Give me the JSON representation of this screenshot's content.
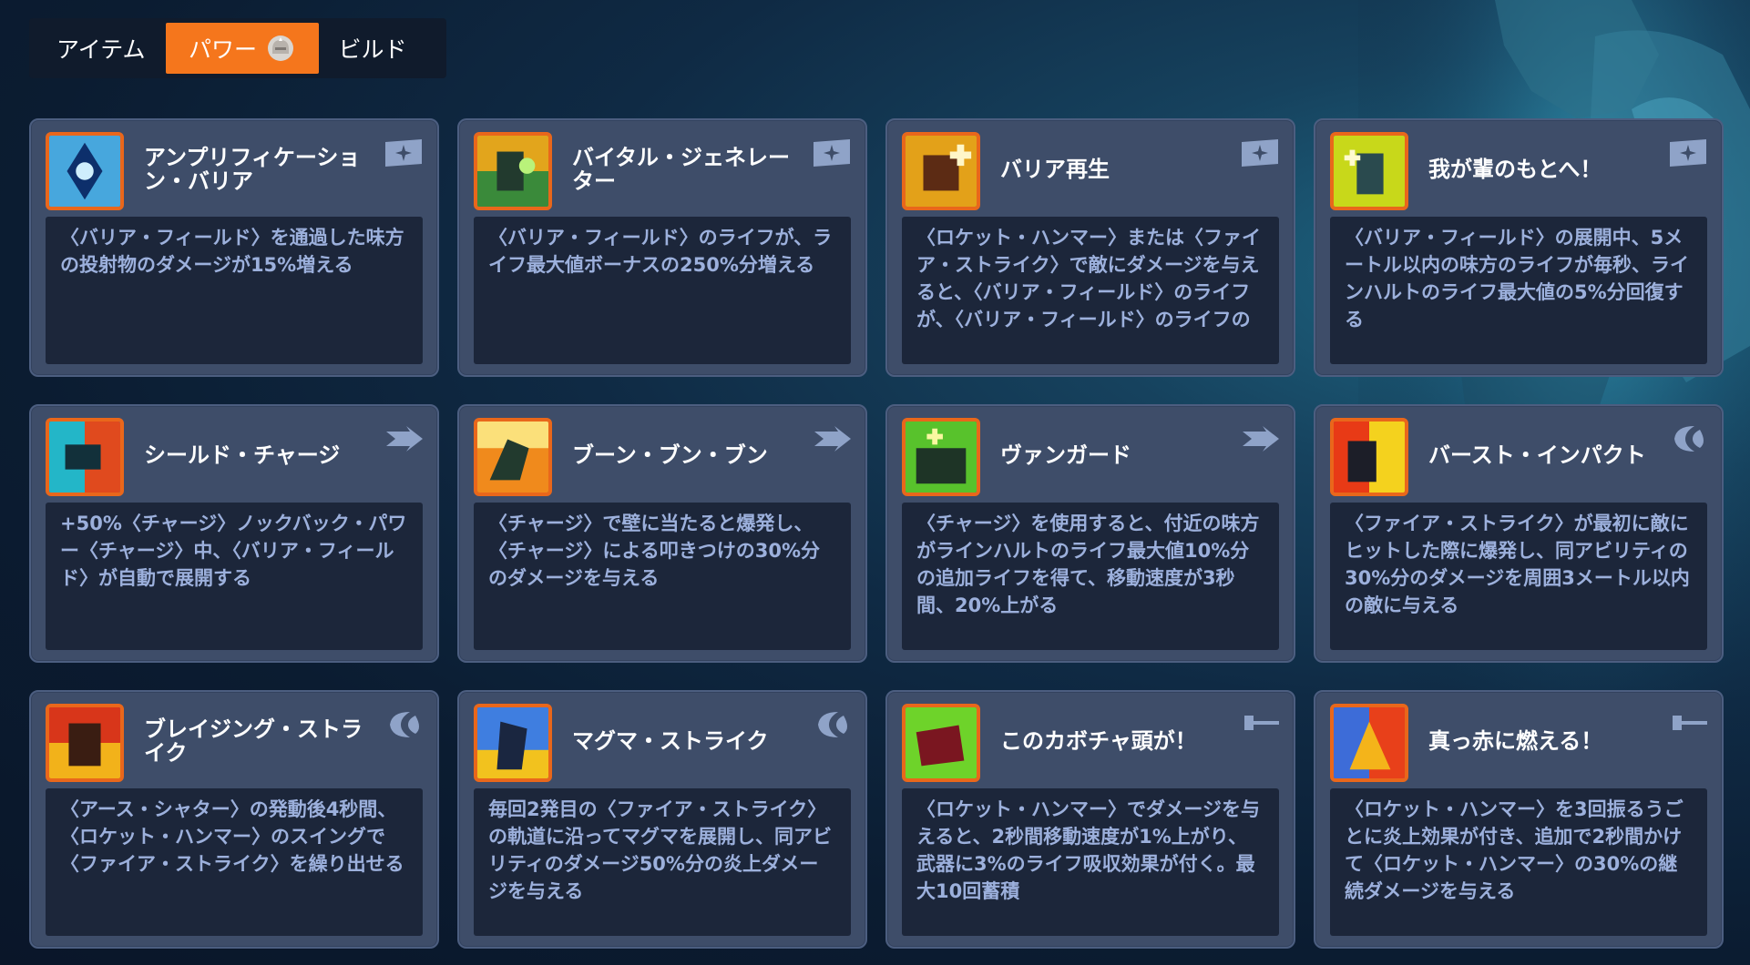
{
  "tabs": [
    {
      "label": "アイテム",
      "active": false
    },
    {
      "label": "パワー",
      "active": true,
      "icon": "helmet-icon"
    },
    {
      "label": "ビルド",
      "active": false
    }
  ],
  "colors": {
    "accent": "#f5761c",
    "card_bg": "#3e4d69",
    "desc_bg": "#1c263a",
    "highlight_text": "#9cb0dc"
  },
  "powers": [
    {
      "title": "アンプリフィケーション・バリア",
      "type_icon": "barrier-icon",
      "desc": [
        [
          "〈バリア・フィールド〉を通過した味方の投射物のダメージが",
          "w"
        ],
        [
          "15%",
          "w"
        ],
        [
          "増える",
          "w"
        ]
      ],
      "desc_text": "〈バリア・フィールド〉を通過した味方の投射物のダメージが15%増える"
    },
    {
      "title": "バイタル・ジェネレーター",
      "type_icon": "barrier-icon",
      "desc_text": "〈バリア・フィールド〉のライフが、ライフ最大値ボーナスの250%分増える"
    },
    {
      "title": "バリア再生",
      "type_icon": "barrier-icon",
      "desc_text": "〈ロケット・ハンマー〉または〈ファイア・ストライク〉で敵にダメージを与えると、〈バリア・フィールド〉のライフが、〈バリア・フィールド〉のライフの"
    },
    {
      "title": "我が輩のもとへ！",
      "type_icon": "barrier-icon",
      "desc_text": "〈バリア・フィールド〉の展開中、5メートル以内の味方のライフが毎秒、ラインハルトのライフ最大値の5%分回復する"
    },
    {
      "title": "シールド・チャージ",
      "type_icon": "charge-icon",
      "desc_text": "+50%〈チャージ〉ノックバック・パワー〈チャージ〉中、〈バリア・フィールド〉が自動で展開する"
    },
    {
      "title": "ブーン・ブン・ブン",
      "type_icon": "charge-icon",
      "desc_text": "〈チャージ〉で壁に当たると爆発し、〈チャージ〉による叩きつけの30%分のダメージを与える"
    },
    {
      "title": "ヴァンガード",
      "type_icon": "charge-icon",
      "desc_text": "〈チャージ〉を使用すると、付近の味方がラインハルトのライフ最大値10%分の追加ライフを得て、移動速度が3秒間、20%上がる"
    },
    {
      "title": "バースト・インパクト",
      "type_icon": "fire-strike-icon",
      "desc_text": "〈ファイア・ストライク〉が最初に敵にヒットした際に爆発し、同アビリティの30%分のダメージを周囲3メートル以内の敵に与える"
    },
    {
      "title": "ブレイジング・ストライク",
      "type_icon": "fire-strike-icon",
      "desc_text": "〈アース・シャター〉の発動後4秒間、〈ロケット・ハンマー〉のスイングで〈ファイア・ストライク〉を繰り出せる"
    },
    {
      "title": "マグマ・ストライク",
      "type_icon": "fire-strike-icon",
      "desc_text": "毎回2発目の〈ファイア・ストライク〉の軌道に沿ってマグマを展開し、同アビリティのダメージ50%分の炎上ダメージを与える"
    },
    {
      "title": "このカボチャ頭が！",
      "type_icon": "hammer-icon",
      "desc_text": "〈ロケット・ハンマー〉でダメージを与えると、2秒間移動速度が1%上がり、武器に3%のライフ吸収効果が付く。最大10回蓄積"
    },
    {
      "title": "真っ赤に燃える！",
      "type_icon": "hammer-icon",
      "desc_text": "〈ロケット・ハンマー〉を3回振るうごとに炎上効果が付き、追加で2秒間かけて〈ロケット・ハンマー〉の30%の継続ダメージを与える"
    }
  ]
}
